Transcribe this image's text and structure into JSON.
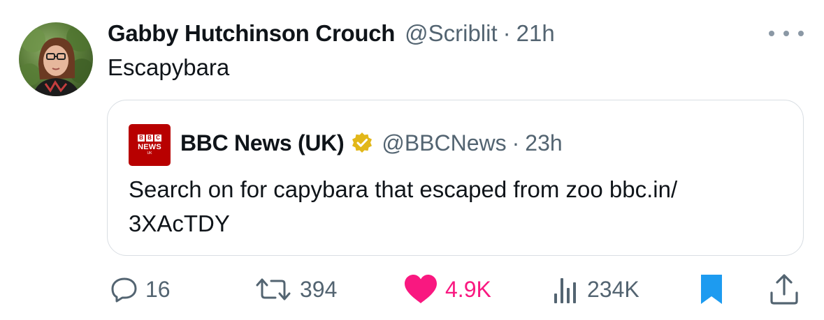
{
  "tweet": {
    "author_name": "Gabby Hutchinson Crouch",
    "handle": "@Scriblit",
    "separator": "·",
    "timestamp": "21h",
    "text": "Escapybara",
    "avatar_icon": "user-avatar-photo",
    "more_icon": "more-dots-icon"
  },
  "quote": {
    "logo": {
      "blocks": [
        "B",
        "B",
        "C"
      ],
      "line1": "NEWS",
      "line2": "UK"
    },
    "author_name": "BBC News (UK)",
    "verified_icon": "gold-verified-badge-icon",
    "handle": "@BBCNews",
    "separator": "·",
    "timestamp": "23h",
    "text_line1": "Search on for capybara that escaped from zoo bbc.in/",
    "text_line2": "3XAcTDY"
  },
  "actions": {
    "replies": "16",
    "reposts": "394",
    "likes": "4.9K",
    "views": "234K",
    "icons": [
      "reply-icon",
      "repost-icon",
      "heart-icon",
      "views-chart-icon",
      "bookmark-icon",
      "share-icon"
    ]
  },
  "colors": {
    "text_primary": "#0f1419",
    "text_secondary": "#536471",
    "like": "#f91880",
    "bookmark": "#1d9bf0",
    "verified_gold": "#e2b719",
    "bbc_red": "#b80000",
    "border": "#d9dee3"
  }
}
